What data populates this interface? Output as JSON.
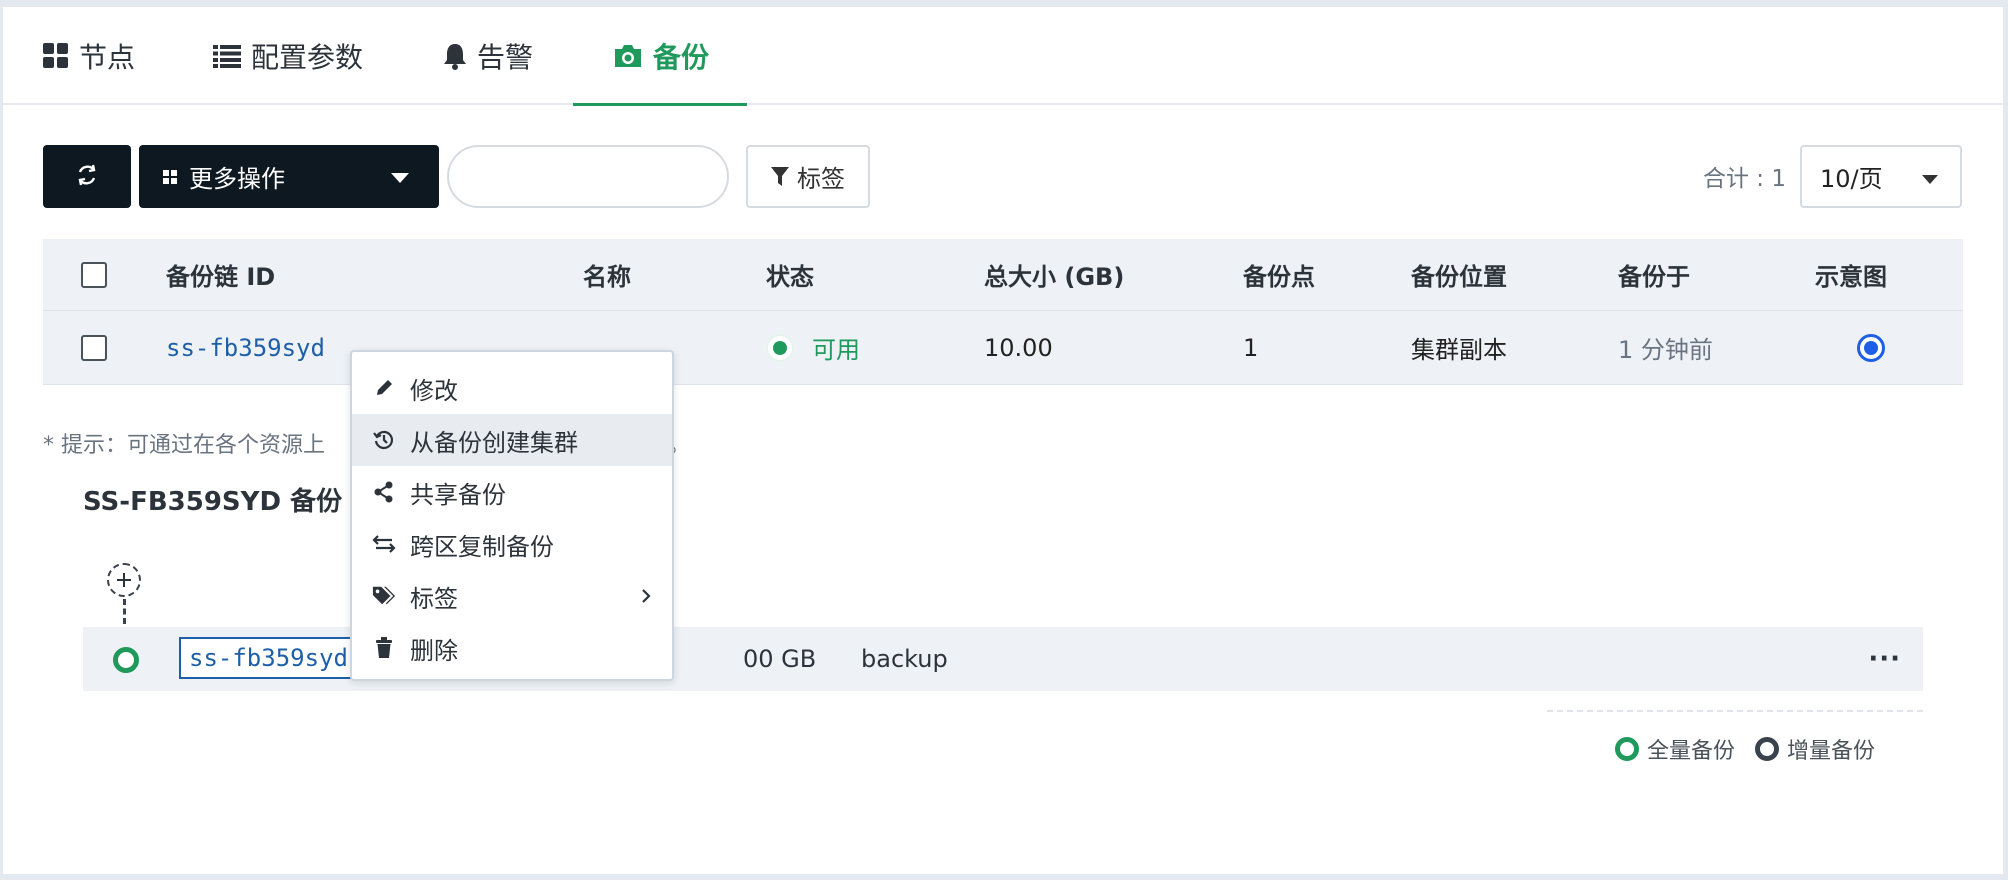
{
  "tabs": [
    {
      "label": "节点",
      "icon": "grid-icon"
    },
    {
      "label": "配置参数",
      "icon": "list-icon"
    },
    {
      "label": "告警",
      "icon": "bell-icon"
    },
    {
      "label": "备份",
      "icon": "camera-icon",
      "active": true
    }
  ],
  "toolbar": {
    "more_label": "更多操作",
    "search_placeholder": "",
    "tag_label": "标签",
    "total_label": "合计 : 1",
    "page_size": "10/页"
  },
  "table": {
    "headers": [
      "备份链 ID",
      "名称",
      "状态",
      "总大小 (GB)",
      "备份点",
      "备份位置",
      "备份于",
      "示意图"
    ],
    "rows": [
      {
        "id": "ss-fb359syd",
        "status": "可用",
        "size": "10.00",
        "points": "1",
        "location": "集群副本",
        "time": "1 分钟前"
      }
    ]
  },
  "tip": "* 提示：可通过在各个资源上",
  "tip_tail": "。",
  "chain": {
    "title": "SS-FB359SYD 备份",
    "node_id": "ss-fb359syd",
    "size": "00 GB",
    "name": "backup",
    "more": "···"
  },
  "legend": {
    "full": "全量备份",
    "incremental": "增量备份",
    "full_color": "#1f9a5c",
    "incremental_color": "#3a434c"
  },
  "context_menu": {
    "items": [
      {
        "label": "修改",
        "icon": "pencil-icon"
      },
      {
        "label": "从备份创建集群",
        "icon": "history-icon"
      },
      {
        "label": "共享备份",
        "icon": "share-icon"
      },
      {
        "label": "跨区复制备份",
        "icon": "transfer-icon"
      },
      {
        "label": "标签",
        "icon": "tags-icon"
      },
      {
        "label": "删除",
        "icon": "trash-icon"
      }
    ]
  },
  "colors": {
    "accent": "#1f9a5c",
    "dark_button": "#0e1820",
    "link": "#1d5fa8",
    "radio": "#1e5fe6"
  }
}
